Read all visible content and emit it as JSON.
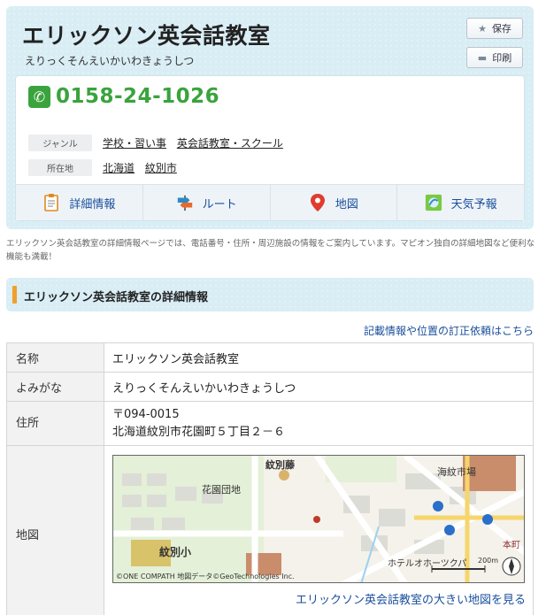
{
  "header": {
    "title": "エリックソン英会話教室",
    "reading": "えりっくそんえいかいわきょうしつ",
    "save_label": "保存",
    "print_label": "印刷"
  },
  "phone": {
    "number": "0158-24-1026"
  },
  "genre": {
    "label": "ジャンル",
    "links": [
      "学校・習い事",
      "英会話教室・スクール"
    ]
  },
  "location": {
    "label": "所在地",
    "links": [
      "北海道",
      "紋別市"
    ]
  },
  "nav": [
    {
      "label": "詳細情報",
      "icon": "document-icon"
    },
    {
      "label": "ルート",
      "icon": "route-sign-icon"
    },
    {
      "label": "地図",
      "icon": "map-pin-icon"
    },
    {
      "label": "天気予報",
      "icon": "weather-icon"
    }
  ],
  "description": "エリックソン英会話教室の詳細情報ページでは、電話番号・住所・周辺施設の情報をご案内しています。マピオン独自の詳細地図など便利な機能も満載！",
  "section": {
    "title": "エリックソン英会話教室の詳細情報",
    "correction_link": "記載情報や位置の訂正依頼はこちら"
  },
  "details": {
    "name_label": "名称",
    "name_value": "エリックソン英会話教室",
    "reading_label": "よみがな",
    "reading_value": "えりっくそんえいかいわきょうしつ",
    "address_label": "住所",
    "postal": "〒094-0015",
    "address_value": "北海道紋別市花園町５丁目２－６",
    "map_label": "地図",
    "map_link": "エリックソン英会話教室の大きい地図を見る"
  },
  "map": {
    "labels": {
      "a": "紋別藤",
      "b": "花園団地",
      "c": "海紋市場",
      "d": "紋別小",
      "e": "ホテルオホーツクパ",
      "f": "本町"
    },
    "credit": "©ONE COMPATH 地図データ©GeoTechnologies Inc.",
    "scale": "200m"
  },
  "colors": {
    "accent_green": "#3aa33d",
    "link_blue": "#1a4f9c",
    "header_bg": "#d9edf5",
    "section_bar": "#f0a12a"
  }
}
